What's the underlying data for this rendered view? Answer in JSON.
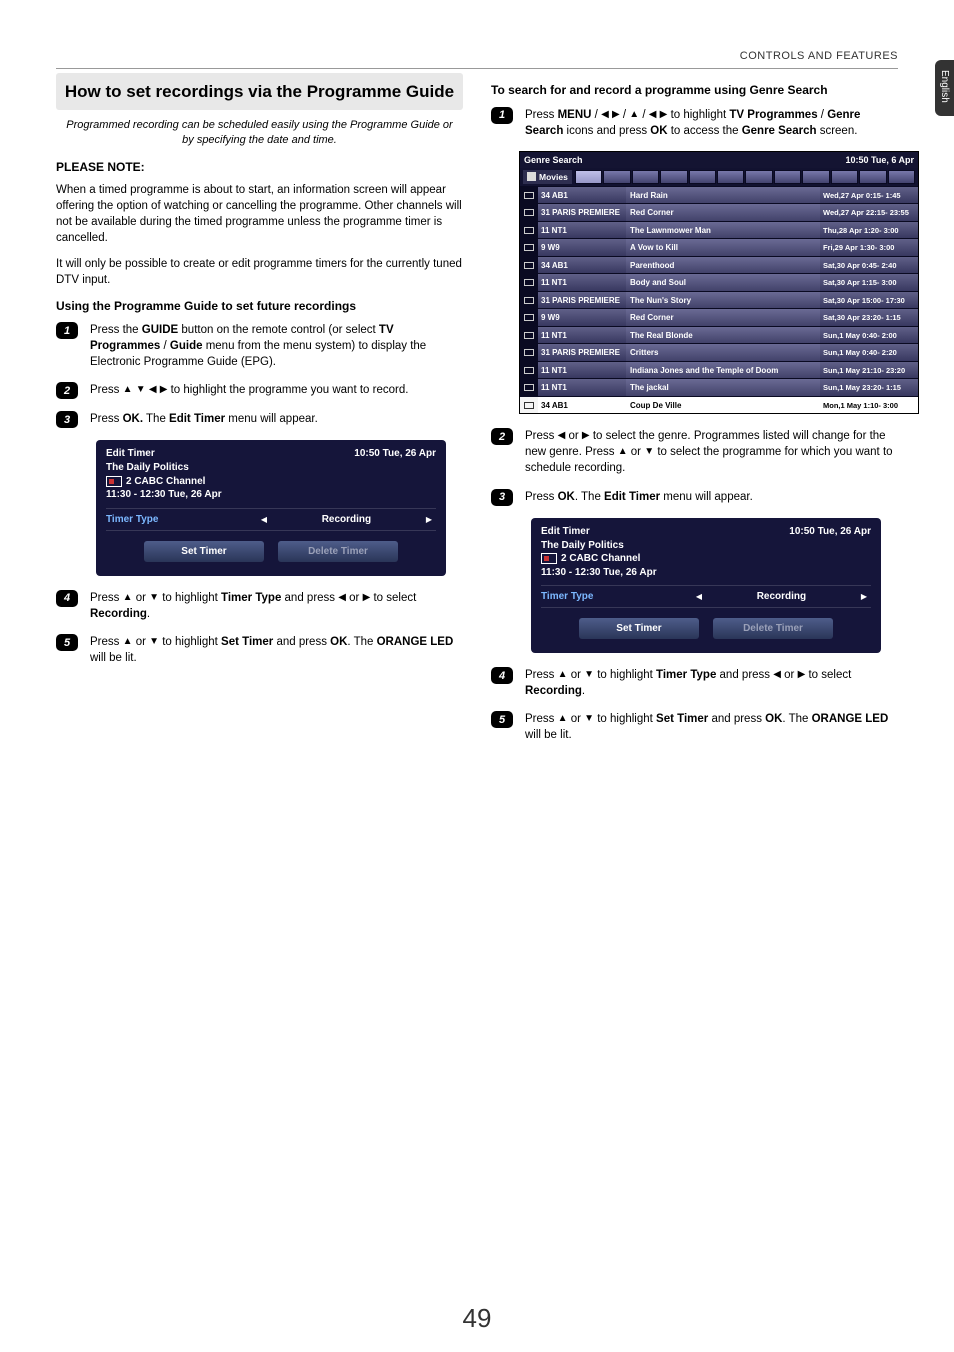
{
  "side_tab": "English",
  "header_right": "CONTROLS AND FEATURES",
  "page_number": "49",
  "left": {
    "section_title": "How to set recordings via the Programme Guide",
    "intro": "Programmed recording can be scheduled easily using the Programme Guide or by specifying the date and time.",
    "please_note": "PLEASE NOTE:",
    "para1": "When a timed programme is about to start, an information screen will appear offering the option of watching or cancelling the programme. Other channels will not be available during the timed programme unless the programme timer is cancelled.",
    "para2": "It will only be possible to create or edit programme timers for the currently tuned DTV input.",
    "subhead": "Using the Programme Guide to set future recordings",
    "steps": {
      "s1a": "Press the ",
      "s1b": "GUIDE",
      "s1c": " button on the remote control (or select ",
      "s1d": "TV Programmes",
      "s1e": " / ",
      "s1f": "Guide",
      "s1g": " menu from the menu system) to display the Electronic Programme Guide (EPG).",
      "s2a": "Press ",
      "s2b": " to highlight the programme you want to record.",
      "s3a": "Press ",
      "s3b": "OK.",
      "s3c": " The ",
      "s3d": "Edit Timer",
      "s3e": " menu will appear.",
      "s4a": "Press ",
      "s4b": " or ",
      "s4c": " to highlight ",
      "s4d": "Timer Type",
      "s4e": " and press ",
      "s4f": " or ",
      "s4g": " to select ",
      "s4h": "Recording",
      "s4i": ".",
      "s5a": "Press ",
      "s5b": " or ",
      "s5c": " to highlight ",
      "s5d": "Set Timer",
      "s5e": " and press ",
      "s5f": "OK",
      "s5g": ". The ",
      "s5h": "ORANGE LED",
      "s5i": " will be lit."
    }
  },
  "right": {
    "subhead": "To search for and record a programme using Genre Search",
    "steps": {
      "s1a": "Press ",
      "s1b": "MENU",
      "s1c": " / ",
      "s1d": " / ",
      "s1e": " / ",
      "s1f": " to highlight ",
      "s1g": "TV Programmes",
      "s1h": " / ",
      "s1i": "Genre Search",
      "s1j": " icons and press ",
      "s1k": "OK",
      "s1l": " to access the ",
      "s1m": "Genre Search",
      "s1n": " screen.",
      "s2a": "Press ",
      "s2b": " or ",
      "s2c": " to select the genre. Programmes listed will change for the new genre. Press ",
      "s2d": " or ",
      "s2e": " to select the programme for which you want to schedule recording.",
      "s3a": "Press ",
      "s3b": "OK",
      "s3c": ". The ",
      "s3d": "Edit Timer",
      "s3e": " menu will appear.",
      "s4a": "Press ",
      "s4b": " or ",
      "s4c": " to highlight ",
      "s4d": "Timer Type",
      "s4e": " and press ",
      "s4f": " or ",
      "s4g": " to select ",
      "s4h": "Recording",
      "s4i": ".",
      "s5a": "Press ",
      "s5b": " or ",
      "s5c": " to highlight ",
      "s5d": "Set Timer",
      "s5e": " and press ",
      "s5f": "OK",
      "s5g": ". The ",
      "s5h": "ORANGE LED",
      "s5i": " will be lit."
    }
  },
  "timer": {
    "title": "Edit Timer",
    "datetime": "10:50 Tue, 26 Apr",
    "prog": "The Daily Politics",
    "chan": "2 CABC Channel",
    "slot": "11:30 - 12:30 Tue, 26 Apr",
    "type_label": "Timer Type",
    "type_value": "Recording",
    "btn_set": "Set Timer",
    "btn_del": "Delete Timer"
  },
  "genre": {
    "title": "Genre Search",
    "datetime": "10:50 Tue, 6 Apr",
    "category": "Movies",
    "rows": [
      {
        "chan": "34 AB1",
        "title": "Hard Rain",
        "time": "Wed,27 Apr 0:15- 1:45"
      },
      {
        "chan": "31 PARIS PREMIERE",
        "title": "Red Corner",
        "time": "Wed,27 Apr 22:15- 23:55"
      },
      {
        "chan": "11 NT1",
        "title": "The Lawnmower Man",
        "time": "Thu,28 Apr 1:20- 3:00"
      },
      {
        "chan": "9   W9",
        "title": "A Vow to Kill",
        "time": "Fri,29 Apr 1:30- 3:00"
      },
      {
        "chan": "34 AB1",
        "title": "Parenthood",
        "time": "Sat,30 Apr 0:45- 2:40"
      },
      {
        "chan": "11 NT1",
        "title": "Body and Soul",
        "time": "Sat,30 Apr 1:15- 3:00"
      },
      {
        "chan": "31 PARIS PREMIERE",
        "title": "The Nun's Story",
        "time": "Sat,30 Apr 15:00- 17:30"
      },
      {
        "chan": "9   W9",
        "title": "Red Corner",
        "time": "Sat,30 Apr 23:20- 1:15"
      },
      {
        "chan": "11 NT1",
        "title": "The Real Blonde",
        "time": "Sun,1 May 0:40- 2:00"
      },
      {
        "chan": "31 PARIS PREMIERE",
        "title": "Critters",
        "time": "Sun,1 May 0:40- 2:20"
      },
      {
        "chan": "11 NT1",
        "title": "Indiana Jones and the Temple of Doom",
        "time": "Sun,1 May 21:10- 23:20"
      },
      {
        "chan": "11 NT1",
        "title": "The jackal",
        "time": "Sun,1 May 23:20- 1:15"
      },
      {
        "chan": "34 AB1",
        "title": "Coup De Ville",
        "time": "Mon,1 May 1:10- 3:00"
      }
    ]
  }
}
